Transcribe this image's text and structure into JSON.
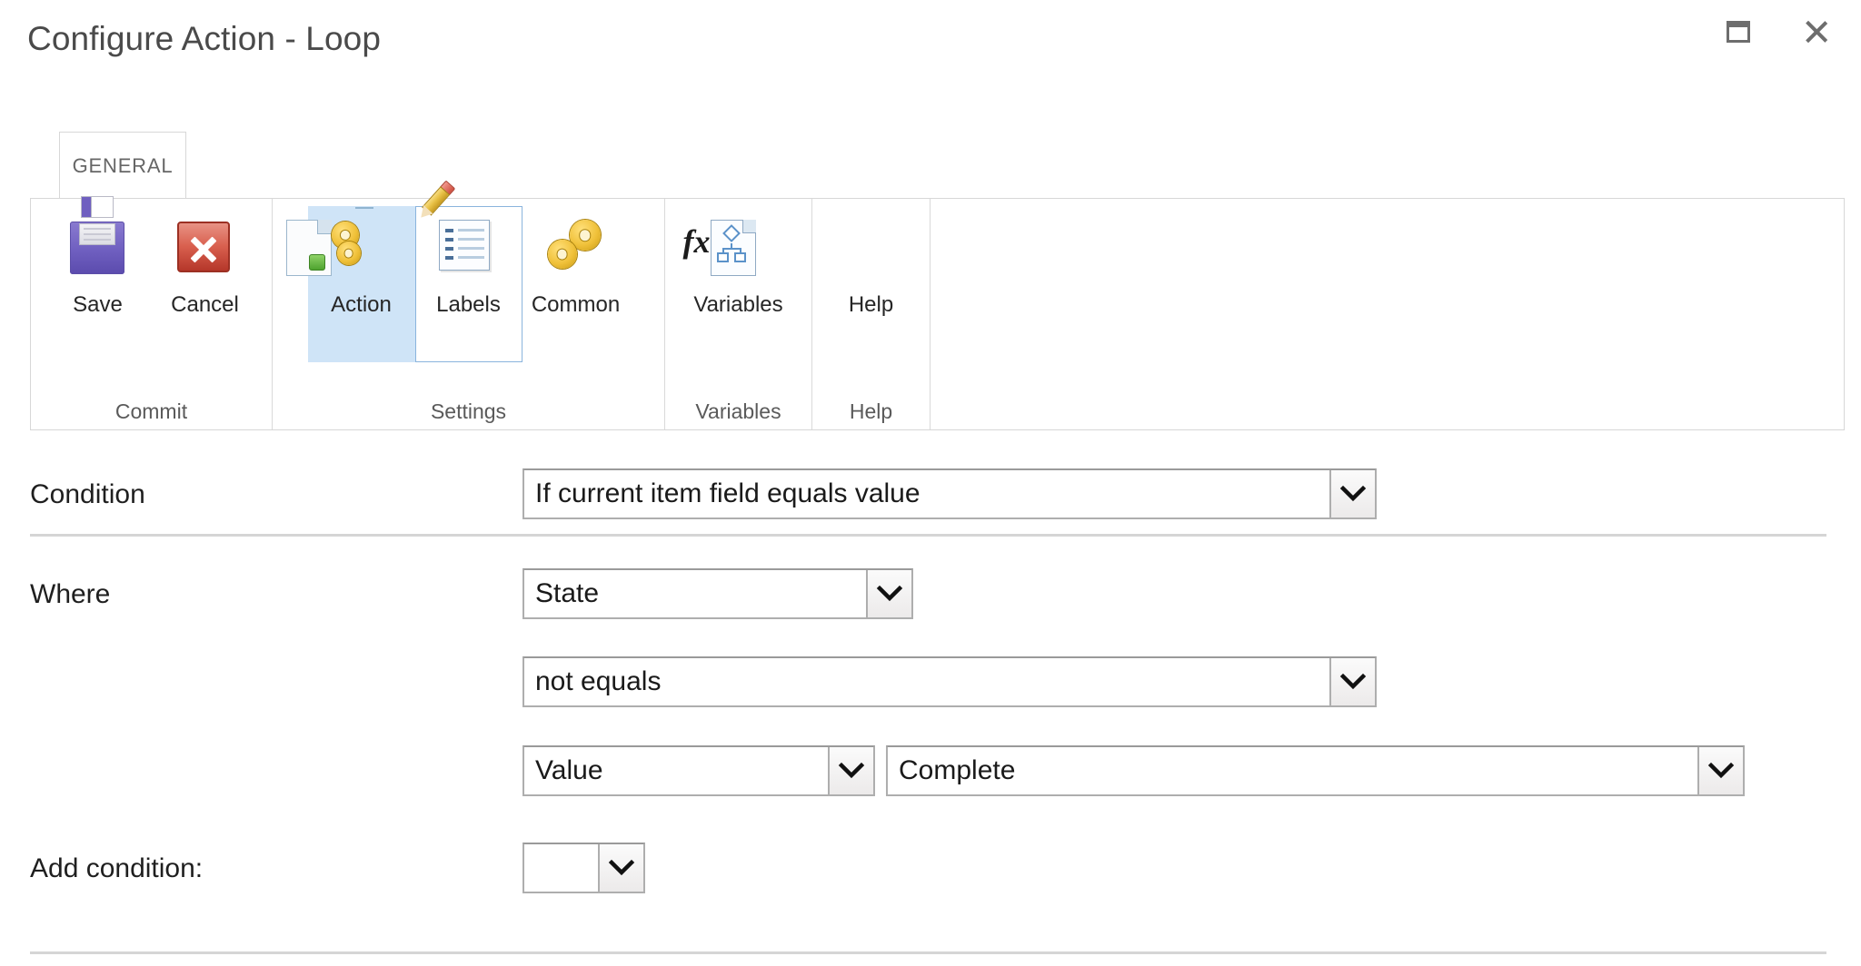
{
  "window": {
    "title": "Configure Action - Loop",
    "controls": [
      {
        "name": "maximize-button",
        "label": "Maximize"
      },
      {
        "name": "close-button",
        "label": "Close"
      }
    ]
  },
  "ribbon": {
    "tabs": [
      {
        "label": "GENERAL",
        "selected": true
      }
    ],
    "groups": [
      {
        "label": "Commit",
        "buttons": [
          {
            "label": "Save",
            "icon": "floppy-disk-icon",
            "state": "normal"
          },
          {
            "label": "Cancel",
            "icon": "red-x-icon",
            "state": "normal"
          }
        ]
      },
      {
        "label": "Settings",
        "buttons": [
          {
            "label": "Action",
            "icon": "gears-document-icon",
            "state": "selected"
          },
          {
            "label": "Labels",
            "icon": "document-pencil-icon",
            "state": "hover"
          },
          {
            "label": "Common",
            "icon": "gears-icon",
            "state": "normal"
          }
        ]
      },
      {
        "label": "Variables",
        "buttons": [
          {
            "label": "Variables",
            "icon": "document-fx-icon",
            "state": "normal"
          }
        ]
      },
      {
        "label": "Help",
        "buttons": [
          {
            "label": "Help",
            "icon": "blue-question-icon",
            "state": "normal"
          }
        ]
      }
    ]
  },
  "form": {
    "condition": {
      "label": "Condition",
      "value": "If current item field equals value"
    },
    "where": {
      "label": "Where",
      "field": {
        "value": "State"
      },
      "operator": {
        "value": "not equals"
      },
      "value_type": {
        "value": "Value"
      },
      "value": {
        "value": "Complete"
      }
    },
    "add_condition": {
      "label": "Add condition:",
      "value": ""
    }
  },
  "colors": {
    "accent_selected": "#cfe4f7",
    "hover_border": "#8ab4dd",
    "separator": "#d5d5d5",
    "title_text": "#4a4a4a",
    "control_border": "#aeaeae"
  }
}
